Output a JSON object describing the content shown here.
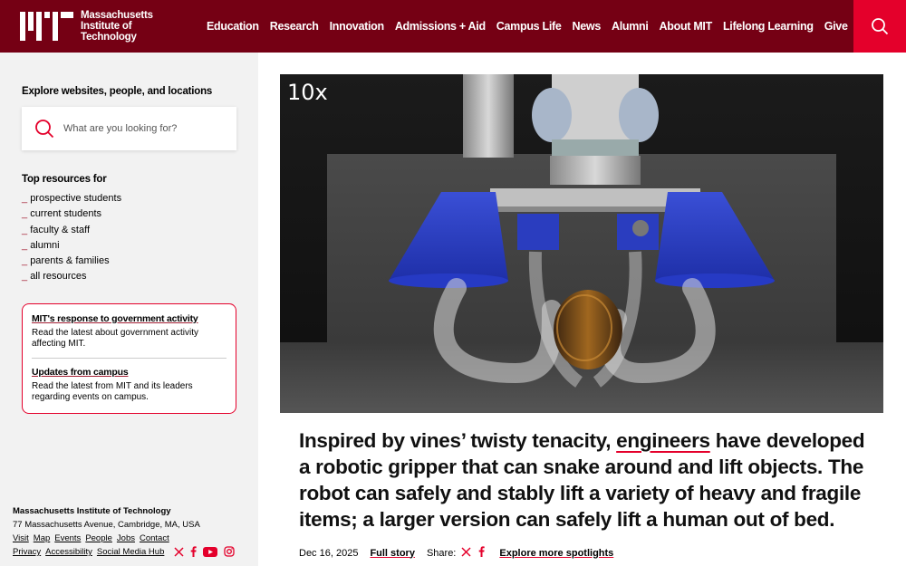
{
  "header": {
    "logo_text_lines": [
      "Massachusetts",
      "Institute of",
      "Technology"
    ],
    "nav": [
      "Education",
      "Research",
      "Innovation",
      "Admissions + Aid",
      "Campus Life",
      "News",
      "Alumni",
      "About MIT",
      "Lifelong Learning",
      "Give"
    ],
    "search_icon": "search-icon"
  },
  "sidebar": {
    "explore_title": "Explore websites, people, and locations",
    "search_placeholder": "What are you looking for?",
    "resources_title": "Top resources for",
    "resources": [
      "prospective students",
      "current students",
      "faculty & staff",
      "alumni",
      "parents & families",
      "all resources"
    ],
    "notices": [
      {
        "title": "MIT's response to government activity",
        "body": "Read the latest about government activity affecting MIT."
      },
      {
        "title": "Updates from campus",
        "body": "Read the latest from MIT and its leaders regarding events on campus."
      }
    ]
  },
  "footer": {
    "name": "Massachusetts Institute of Technology",
    "address": "77 Massachusetts Avenue, Cambridge, MA, USA",
    "links_row1": [
      "Visit",
      "Map",
      "Events",
      "People",
      "Jobs",
      "Contact"
    ],
    "links_row2": [
      "Privacy",
      "Accessibility",
      "Social Media Hub"
    ],
    "social_icons": [
      "x-icon",
      "facebook-icon",
      "youtube-icon",
      "instagram-icon"
    ]
  },
  "hero": {
    "video_label": "10x"
  },
  "story": {
    "headline_pre": "Inspired by vines’ twisty tenacity, ",
    "headline_link": "engineers",
    "headline_post": " have developed a robotic gripper that can snake around and lift objects. The robot can safely and stably lift a variety of heavy and fragile items; a larger version can safely lift a human out of bed.",
    "date": "Dec 16, 2025",
    "full_story": "Full story",
    "share_label": "Share:",
    "explore_more": "Explore more spotlights"
  },
  "colors": {
    "header_bg": "#750014",
    "search_bg": "#e4002b",
    "accent": "#a31f34",
    "sidebar_bg": "#f2f2f2"
  }
}
